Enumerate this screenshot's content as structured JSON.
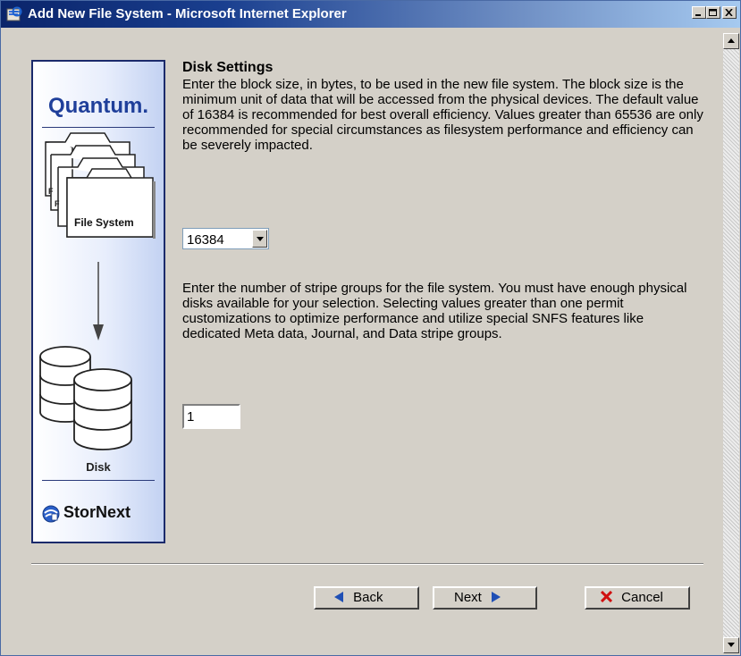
{
  "window": {
    "title": "Add New File System - Microsoft Internet Explorer"
  },
  "graphic": {
    "brand": "Quantum.",
    "file_system_label": "File System",
    "disk_label": "Disk",
    "product": "StorNext",
    "colors": {
      "brand_blue": "#1f3f9a",
      "panel_border": "#1b2a6b"
    }
  },
  "main": {
    "heading": "Disk Settings",
    "block_size_text": "Enter the block size, in bytes, to be used in the new file system. The block size is the minimum unit of data that will be accessed from the physical devices. The default value of 16384 is recommended for best overall efficiency. Values greater than 65536 are only recommended for special circumstances as filesystem performance and efficiency can be severely impacted.",
    "block_size_value": "16384",
    "stripe_groups_text": "Enter the number of stripe groups for the file system. You must have enough physical disks available for your selection. Selecting values greater than one permit customizations to optimize performance and utilize special SNFS features like dedicated Meta data, Journal, and Data stripe groups.",
    "stripe_groups_value": "1"
  },
  "buttons": {
    "back": "Back",
    "next": "Next",
    "cancel": "Cancel",
    "icons": {
      "back": "arrow-left-icon",
      "next": "arrow-right-icon",
      "cancel": "red-x-icon"
    }
  }
}
